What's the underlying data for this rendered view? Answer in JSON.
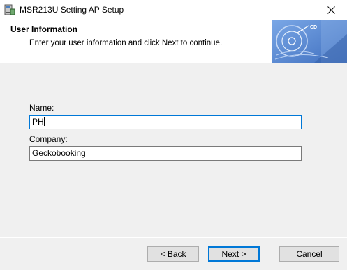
{
  "window": {
    "title": "MSR213U Setting AP Setup",
    "close_icon": "close-icon",
    "app_icon": "installer-icon"
  },
  "header": {
    "title": "User Information",
    "subtitle": "Enter your user information and click Next to continue.",
    "banner_icon": "cd-disc-banner",
    "banner_text": "CD"
  },
  "form": {
    "name_label": "Name:",
    "name_value": "PH",
    "company_label": "Company:",
    "company_value": "Geckobooking"
  },
  "buttons": {
    "back": "< Back",
    "next": "Next >",
    "cancel": "Cancel"
  },
  "colors": {
    "focus": "#0078d7",
    "banner": "#5b8fd6"
  }
}
